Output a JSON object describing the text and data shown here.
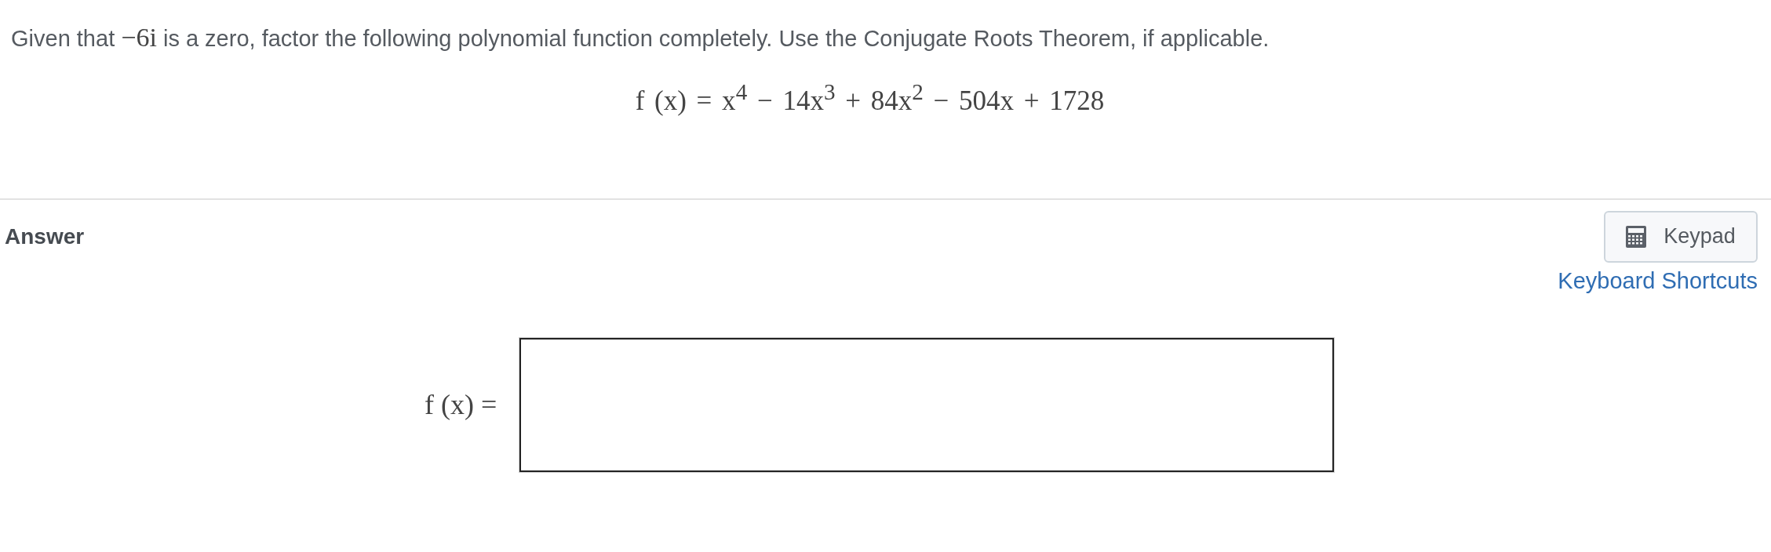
{
  "question": {
    "text_before": "Given that",
    "zero": "−6i",
    "text_after": "is a zero, factor the following polynomial function completely. Use the Conjugate Roots Theorem, if applicable.",
    "formula": "f (x) = x$^{4}$ − 14x$^{3}$ + 84x$^{2}$ − 504x + 1728"
  },
  "answer": {
    "heading": "Answer",
    "keypad_button": "Keypad",
    "shortcuts_link": "Keyboard Shortcuts",
    "field_label": "f (x) ="
  }
}
